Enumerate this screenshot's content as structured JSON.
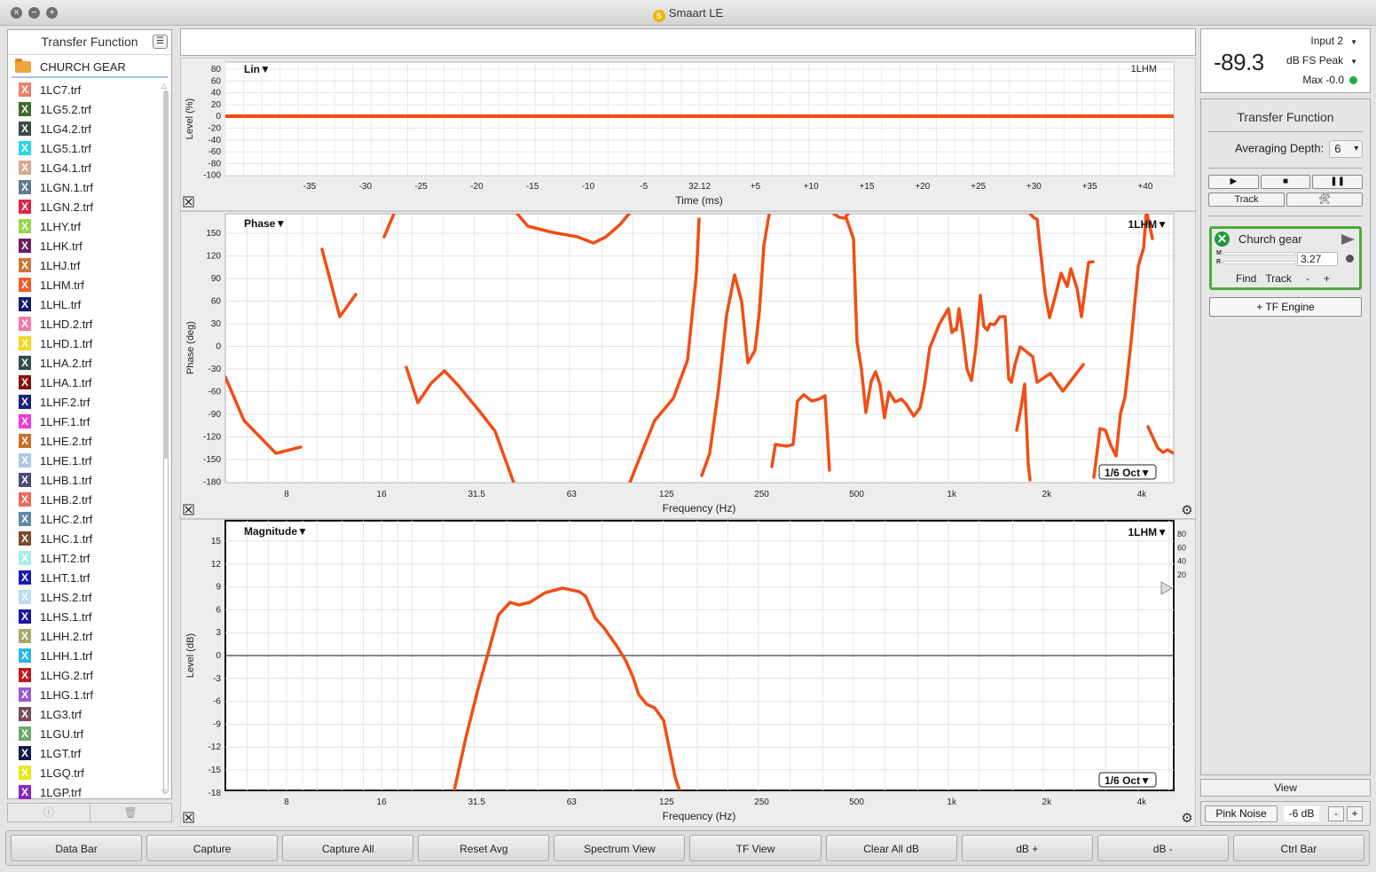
{
  "window": {
    "title": "Smaart LE"
  },
  "sidebar": {
    "title": "Transfer Function",
    "folder": "CHURCH GEAR",
    "files": [
      {
        "name": "1LC7.trf",
        "color": "#e8826e"
      },
      {
        "name": "1LG5.2.trf",
        "color": "#3b6b2a"
      },
      {
        "name": "1LG4.2.trf",
        "color": "#3b4a45"
      },
      {
        "name": "1LG5.1.trf",
        "color": "#27d7e3"
      },
      {
        "name": "1LG4.1.trf",
        "color": "#d9a98c"
      },
      {
        "name": "1LGN.1.trf",
        "color": "#5d7b8f"
      },
      {
        "name": "1LGN.2.trf",
        "color": "#e0244a"
      },
      {
        "name": "1LHY.trf",
        "color": "#97d44a"
      },
      {
        "name": "1LHK.trf",
        "color": "#6a1d5e"
      },
      {
        "name": "1LHJ.trf",
        "color": "#c9773a"
      },
      {
        "name": "1LHM.trf",
        "color": "#f25b24"
      },
      {
        "name": "1LHL.trf",
        "color": "#141c6e"
      },
      {
        "name": "1LHD.2.trf",
        "color": "#f07aa8"
      },
      {
        "name": "1LHD.1.trf",
        "color": "#f5d51f"
      },
      {
        "name": "1LHA.2.trf",
        "color": "#2f4f4a"
      },
      {
        "name": "1LHA.1.trf",
        "color": "#8a1111"
      },
      {
        "name": "1LHF.2.trf",
        "color": "#16207a"
      },
      {
        "name": "1LHF.1.trf",
        "color": "#f23ad8"
      },
      {
        "name": "1LHE.2.trf",
        "color": "#c7702b"
      },
      {
        "name": "1LHE.1.trf",
        "color": "#aec5e6"
      },
      {
        "name": "1LHB.1.trf",
        "color": "#4a4a7a"
      },
      {
        "name": "1LHB.2.trf",
        "color": "#ea6a5a"
      },
      {
        "name": "1LHC.2.trf",
        "color": "#5a8aa8"
      },
      {
        "name": "1LHC.1.trf",
        "color": "#7a4a2a"
      },
      {
        "name": "1LHT.2.trf",
        "color": "#a8ecea"
      },
      {
        "name": "1LHT.1.trf",
        "color": "#1a1ab8"
      },
      {
        "name": "1LHS.2.trf",
        "color": "#b8e0ee"
      },
      {
        "name": "1LHS.1.trf",
        "color": "#1a1a9a"
      },
      {
        "name": "1LHH.2.trf",
        "color": "#a8a86a"
      },
      {
        "name": "1LHH.1.trf",
        "color": "#2ab8e8"
      },
      {
        "name": "1LHG.2.trf",
        "color": "#c01a1a"
      },
      {
        "name": "1LHG.1.trf",
        "color": "#9a5ad8"
      },
      {
        "name": "1LG3.trf",
        "color": "#7a4a5a"
      },
      {
        "name": "1LGU.trf",
        "color": "#6aaa6a"
      },
      {
        "name": "1LGT.trf",
        "color": "#141c4a"
      },
      {
        "name": "1LGQ.trf",
        "color": "#e8e81a"
      },
      {
        "name": "1LGP.trf",
        "color": "#8a2ab8"
      }
    ],
    "footer_info_icon": "info-icon",
    "footer_trash_icon": "trash-icon"
  },
  "meter": {
    "value": "-89.3",
    "input": "Input 2",
    "unit": "dB FS Peak",
    "max": "Max -0.0",
    "status_color": "#1fae3e"
  },
  "panel": {
    "title": "Transfer Function",
    "averaging_label": "Averaging Depth:",
    "averaging_value": "6",
    "transport": [
      "▶",
      "■",
      "❚❚"
    ],
    "track_label": "Track",
    "tools_icon": "🛠",
    "engine": {
      "name": "Church gear",
      "m_label": "M",
      "r_label": "R",
      "value": "3.27",
      "find": "Find",
      "track": "Track",
      "minus": "-",
      "plus": "+"
    },
    "add_engine": "+ TF Engine",
    "view": "View",
    "pink_noise": "Pink Noise",
    "gen_level": "-6 dB",
    "gen_minus": "-",
    "gen_plus": "+"
  },
  "plots": {
    "impulse": {
      "mode": "Lin▼",
      "tag": "1LHM",
      "ylabel": "Level (%)",
      "xlabel": "Time (ms)",
      "yticks": [
        "80",
        "60",
        "40",
        "20",
        "0",
        "-20",
        "-40",
        "-60",
        "-80",
        "-100"
      ],
      "xticks": [
        "-35",
        "-30",
        "-25",
        "-20",
        "-15",
        "-10",
        "-5",
        "32.12",
        "+5",
        "+10",
        "+15",
        "+20",
        "+25",
        "+30",
        "+35",
        "+40"
      ]
    },
    "phase": {
      "mode": "Phase▼",
      "tag": "1LHM▼",
      "ylabel": "Phase (deg)",
      "xlabel": "Frequency (Hz)",
      "smoothing": "1/6 Oct▼",
      "yticks": [
        "150",
        "120",
        "90",
        "60",
        "30",
        "0",
        "-30",
        "-60",
        "-90",
        "-120",
        "-150",
        "-180"
      ],
      "xticks": [
        "8",
        "16",
        "31.5",
        "63",
        "125",
        "250",
        "500",
        "1k",
        "2k",
        "4k"
      ]
    },
    "magnitude": {
      "mode": "Magnitude▼",
      "tag": "1LHM▼",
      "ylabel": "Level (dB)",
      "xlabel": "Frequency (Hz)",
      "smoothing": "1/6 Oct▼",
      "yticks": [
        "15",
        "12",
        "9",
        "6",
        "3",
        "0",
        "-3",
        "-6",
        "-9",
        "-12",
        "-15",
        "-18"
      ],
      "xticks": [
        "8",
        "16",
        "31.5",
        "63",
        "125",
        "250",
        "500",
        "1k",
        "2k",
        "4k"
      ],
      "coherence_ticks": [
        "80",
        "60",
        "40",
        "20"
      ]
    }
  },
  "commands": [
    "Data Bar",
    "Capture",
    "Capture All",
    "Reset Avg",
    "Spectrum View",
    "TF View",
    "Clear All dB",
    "dB +",
    "dB -",
    "Ctrl Bar"
  ],
  "trace_color": "#f04e16"
}
